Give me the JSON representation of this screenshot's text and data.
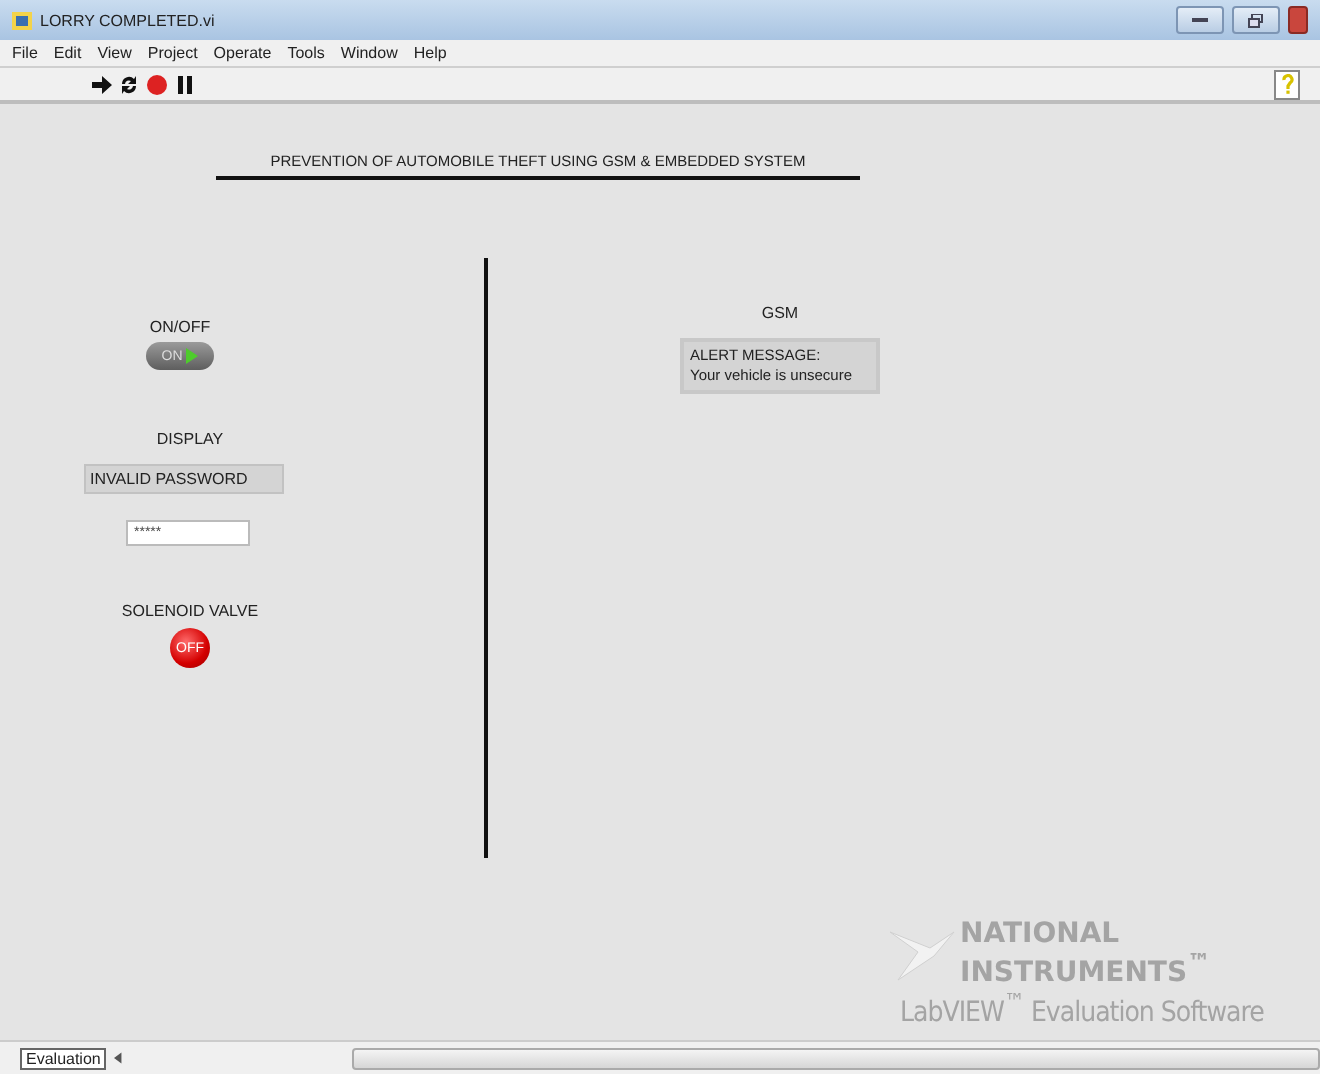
{
  "window": {
    "title": "LORRY COMPLETED.vi"
  },
  "menu": [
    "File",
    "Edit",
    "View",
    "Project",
    "Operate",
    "Tools",
    "Window",
    "Help"
  ],
  "panel": {
    "heading": "PREVENTION OF AUTOMOBILE THEFT USING GSM & EMBEDDED SYSTEM",
    "controls": [
      {
        "kind": "switch",
        "label": "ON/OFF",
        "on": true,
        "text": "ON"
      },
      {
        "kind": "indicator",
        "label": "DISPLAY",
        "value": "INVALID PASSWORD"
      },
      {
        "kind": "password",
        "value": "*****"
      },
      {
        "kind": "led",
        "label": "SOLENOID VALVE",
        "on": false,
        "text": "OFF"
      }
    ],
    "gsm": {
      "label": "GSM",
      "message": [
        "ALERT MESSAGE:",
        "Your vehicle is unsecure"
      ]
    }
  },
  "watermark": {
    "lines": [
      "NATIONAL",
      "INSTRUMENTS$^{™}$",
      "LabVIEW$^{™}$ Evaluation Software"
    ]
  },
  "status_bar": {
    "context": "Evaluation"
  }
}
